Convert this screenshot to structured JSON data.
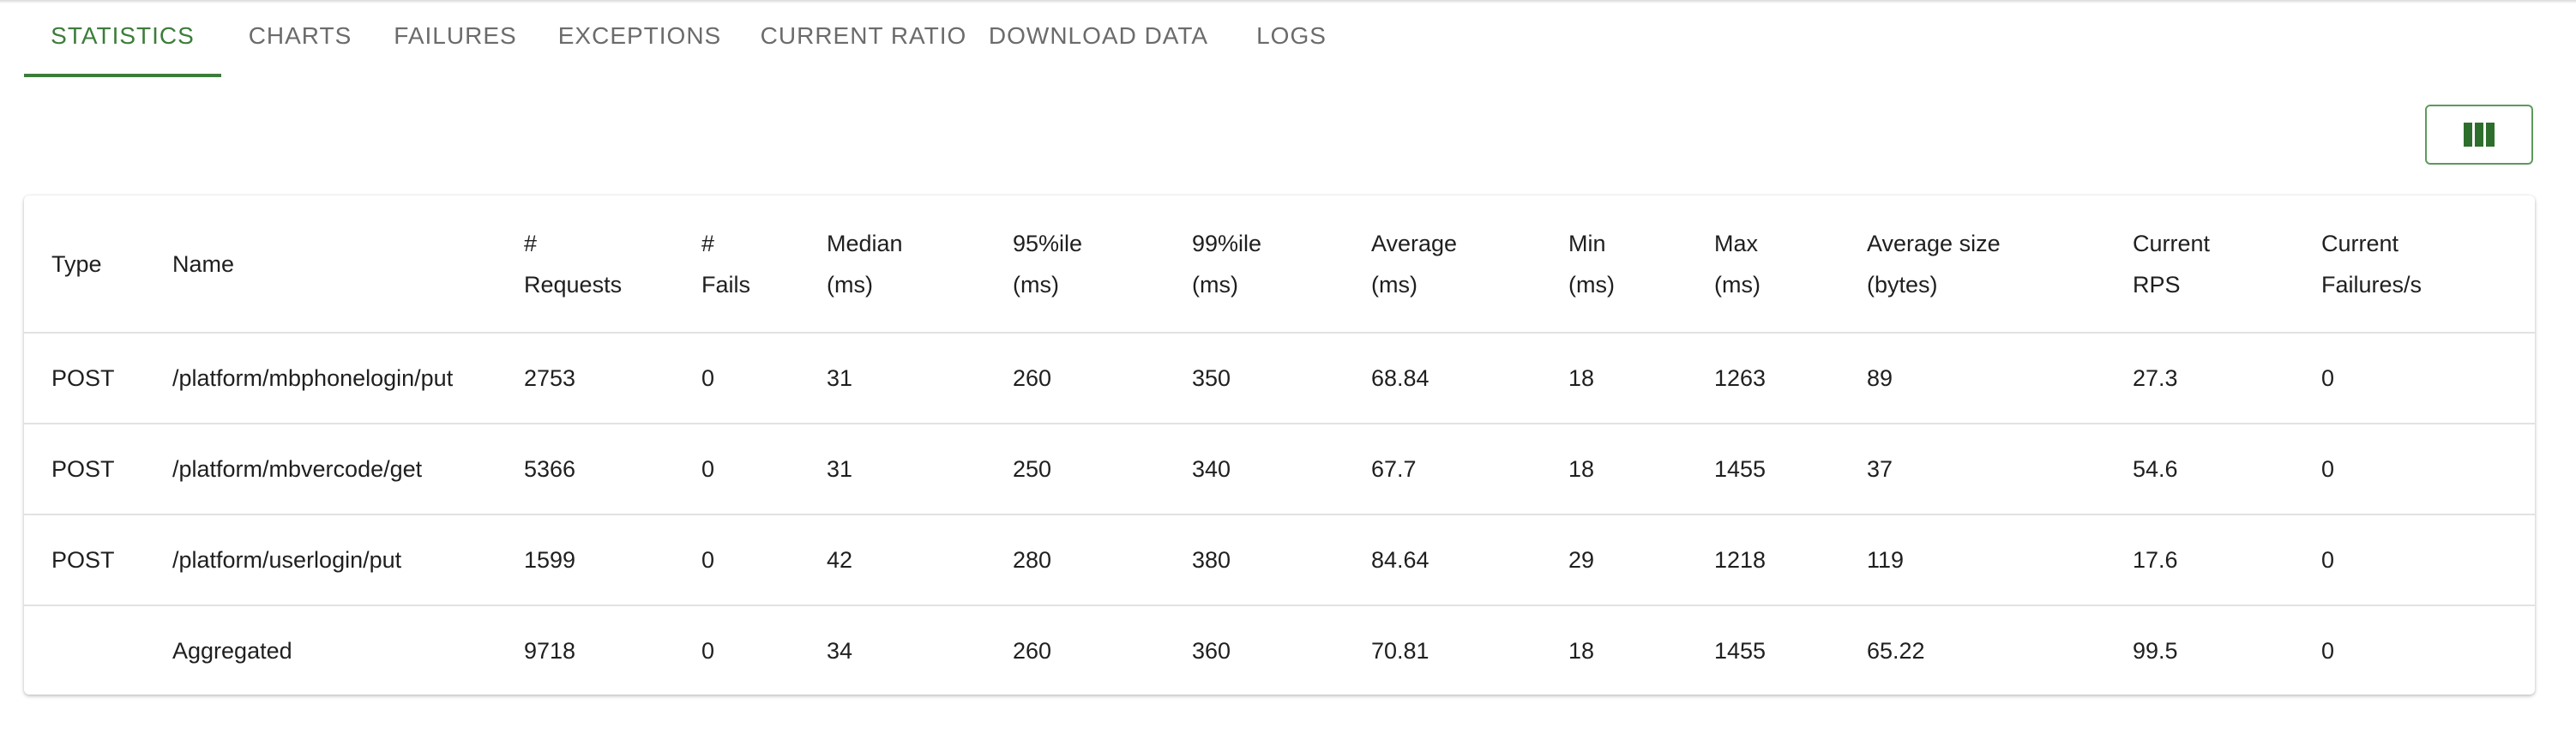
{
  "tabs": [
    {
      "label": "STATISTICS",
      "active": true
    },
    {
      "label": "CHARTS",
      "active": false
    },
    {
      "label": "FAILURES",
      "active": false
    },
    {
      "label": "EXCEPTIONS",
      "active": false
    },
    {
      "label": "CURRENT RATIO",
      "active": false
    },
    {
      "label": "DOWNLOAD DATA",
      "active": false
    },
    {
      "label": "LOGS",
      "active": false
    }
  ],
  "toolbar": {
    "columns_button_icon": "view-column-icon"
  },
  "colors": {
    "accent": "#3c7d3a",
    "tab_inactive": "#6b6b6b",
    "row_divider": "#e2e2e2"
  },
  "table": {
    "headers": [
      {
        "line1": "Type",
        "line2": ""
      },
      {
        "line1": "Name",
        "line2": ""
      },
      {
        "line1": "#",
        "line2": "Requests"
      },
      {
        "line1": "#",
        "line2": "Fails"
      },
      {
        "line1": "Median",
        "line2": "(ms)"
      },
      {
        "line1": "95%ile",
        "line2": "(ms)"
      },
      {
        "line1": "99%ile",
        "line2": "(ms)"
      },
      {
        "line1": "Average",
        "line2": "(ms)"
      },
      {
        "line1": "Min",
        "line2": "(ms)"
      },
      {
        "line1": "Max",
        "line2": "(ms)"
      },
      {
        "line1": "Average size",
        "line2": "(bytes)"
      },
      {
        "line1": "Current",
        "line2": "RPS"
      },
      {
        "line1": "Current",
        "line2": "Failures/s"
      }
    ],
    "rows": [
      [
        "POST",
        "/platform/mbphonelogin/put",
        "2753",
        "0",
        "31",
        "260",
        "350",
        "68.84",
        "18",
        "1263",
        "89",
        "27.3",
        "0"
      ],
      [
        "POST",
        "/platform/mbvercode/get",
        "5366",
        "0",
        "31",
        "250",
        "340",
        "67.7",
        "18",
        "1455",
        "37",
        "54.6",
        "0"
      ],
      [
        "POST",
        "/platform/userlogin/put",
        "1599",
        "0",
        "42",
        "280",
        "380",
        "84.64",
        "29",
        "1218",
        "119",
        "17.6",
        "0"
      ],
      [
        "",
        "Aggregated",
        "9718",
        "0",
        "34",
        "260",
        "360",
        "70.81",
        "18",
        "1455",
        "65.22",
        "99.5",
        "0"
      ]
    ]
  }
}
